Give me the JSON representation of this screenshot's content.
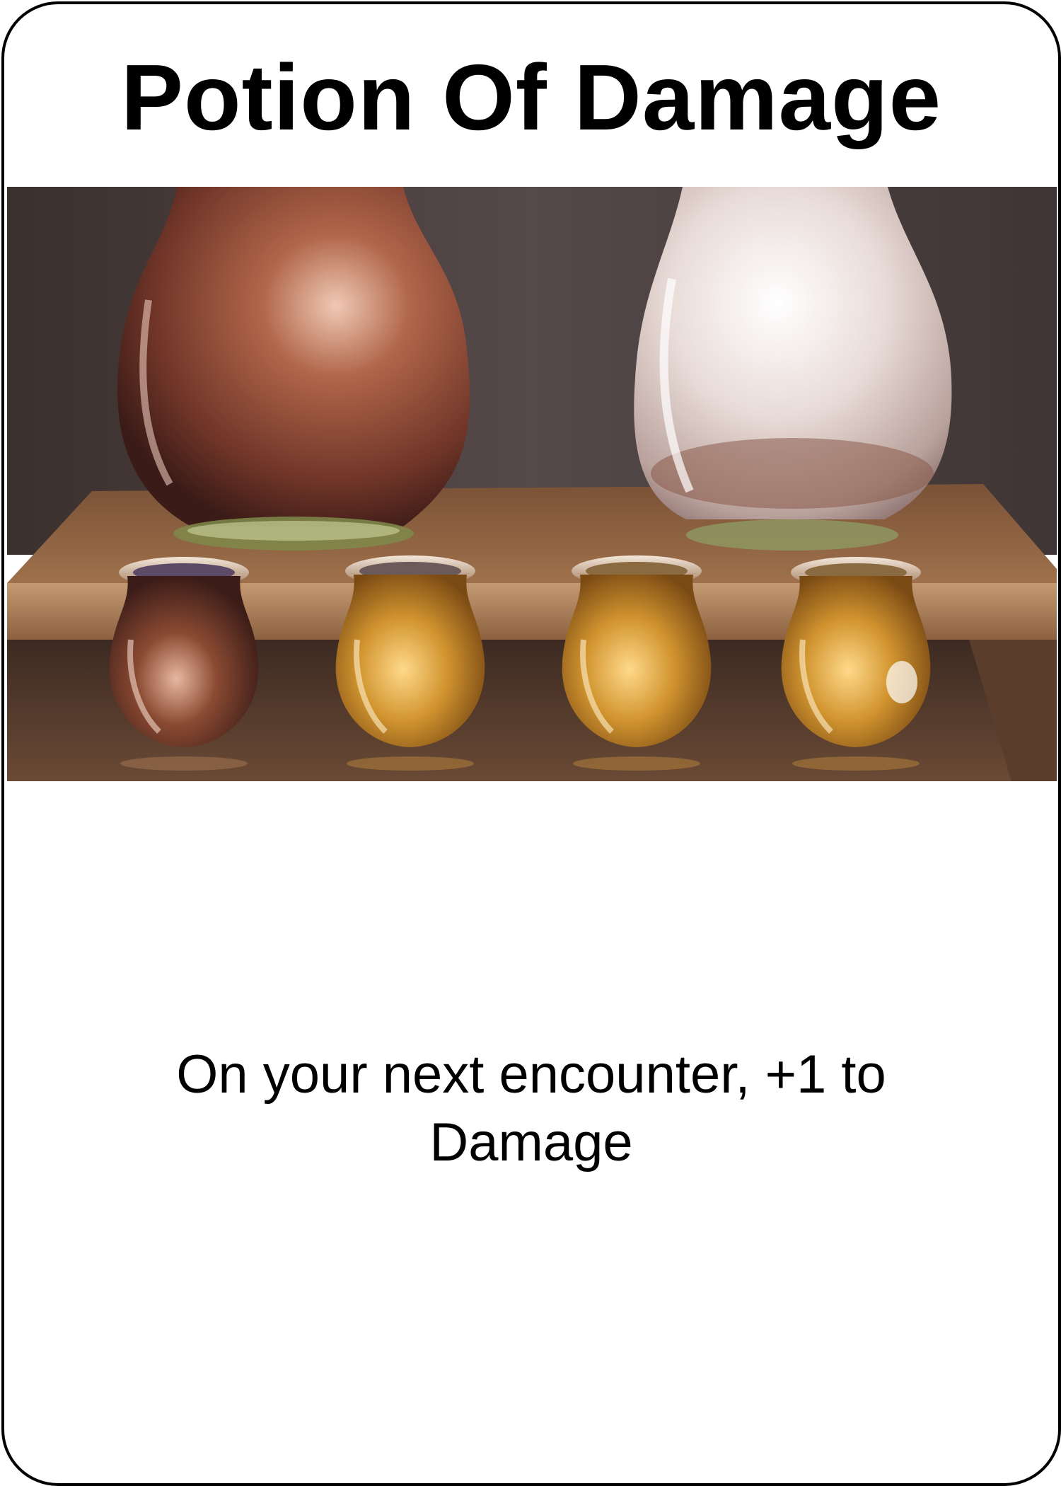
{
  "card": {
    "title": "Potion Of Damage",
    "effect_text": "On your next encounter, +1 to Damage",
    "art": {
      "subject": "two large glass bottles and four small golden potion jars on a wooden shelf",
      "colors": {
        "wall": "#4a3f3b",
        "shelf": "#9a6b45",
        "left_bottle": "#8a4b35",
        "right_bottle": "#d8c9c4",
        "jar_gold": "#c98a2a",
        "jar_dark": "#6b3523"
      }
    }
  }
}
